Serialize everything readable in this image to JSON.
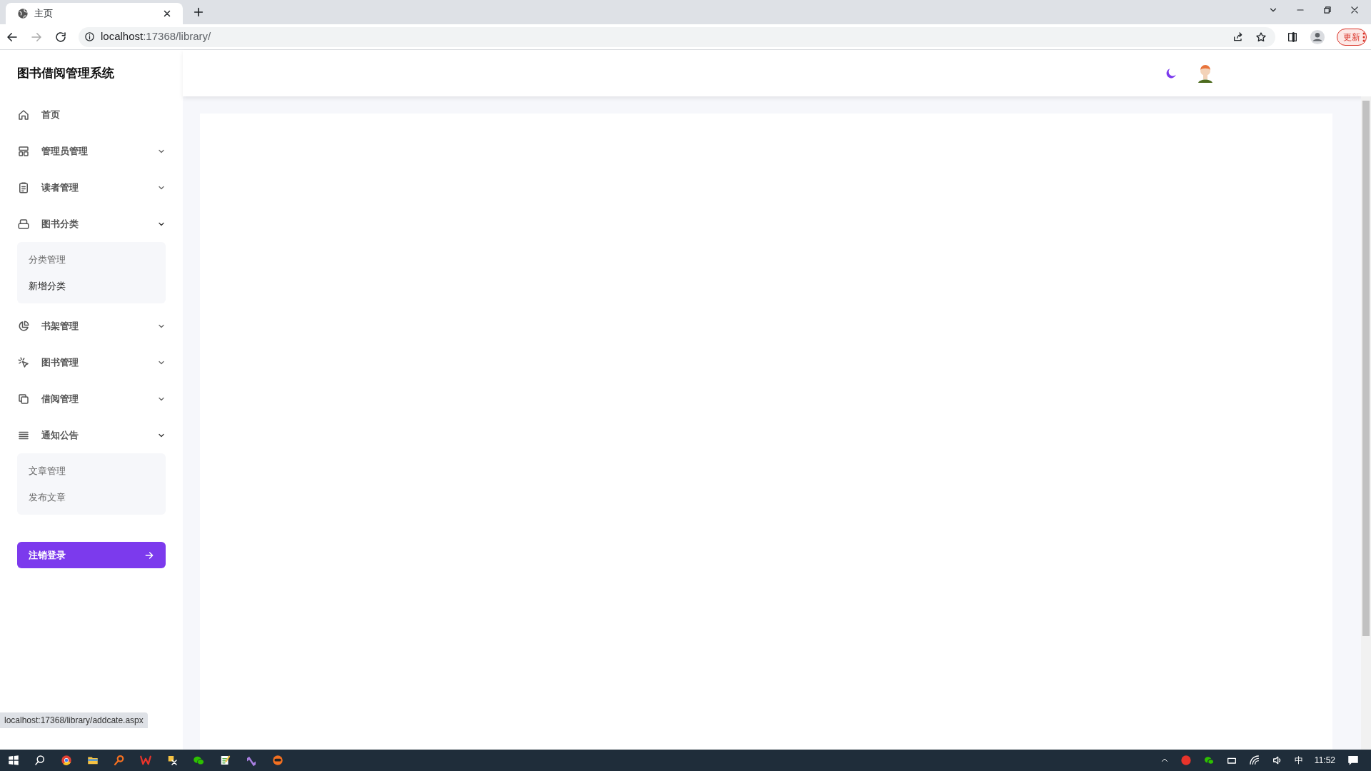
{
  "browser": {
    "tab_title": "主页",
    "url_host": "localhost",
    "url_path": ":17368/library/",
    "update_button": "更新"
  },
  "app": {
    "title": "图书借阅管理系统"
  },
  "sidebar": {
    "items": [
      {
        "label": "首页"
      },
      {
        "label": "管理员管理",
        "expanded": false
      },
      {
        "label": "读者管理",
        "expanded": false
      },
      {
        "label": "图书分类",
        "expanded": true,
        "children": [
          {
            "label": "分类管理",
            "hovered": false
          },
          {
            "label": "新增分类",
            "hovered": true
          }
        ]
      },
      {
        "label": "书架管理",
        "expanded": false
      },
      {
        "label": "图书管理",
        "expanded": false
      },
      {
        "label": "借阅管理",
        "expanded": false
      },
      {
        "label": "通知公告",
        "expanded": true,
        "children": [
          {
            "label": "文章管理",
            "hovered": false
          },
          {
            "label": "发布文章",
            "hovered": false
          }
        ]
      }
    ],
    "logout_button": "注销登录"
  },
  "status_bar": {
    "link_url": "localhost:17368/library/addcate.aspx"
  },
  "taskbar": {
    "input_method": "中",
    "time": "11:52"
  }
}
